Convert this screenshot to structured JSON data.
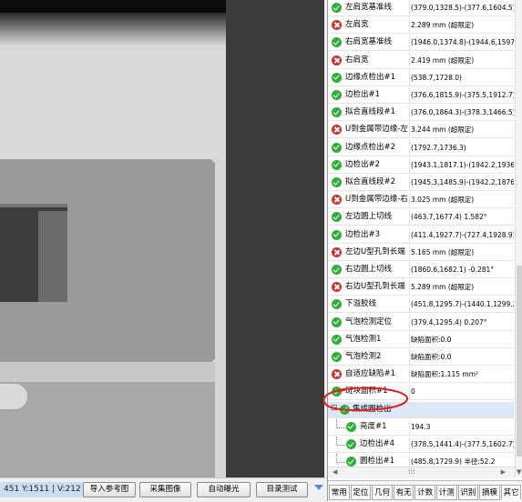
{
  "status_bar": {
    "coords": "451 Y:1511 | V:212",
    "buttons": [
      "导入参考图",
      "采集图像",
      "自动曝光",
      "目录测试"
    ]
  },
  "results": [
    {
      "status": "ok",
      "name": "左肩宽基准线",
      "value": "(379.0,1328.5)-(377.6,1604.5)"
    },
    {
      "status": "fail",
      "name": "左肩宽",
      "value": "2.289 mm (超限定)"
    },
    {
      "status": "ok",
      "name": "右肩宽基准线",
      "value": "(1946.0,1374.8)-(1944.6,1597."
    },
    {
      "status": "fail",
      "name": "右肩宽",
      "value": "2.419 mm (超限定)"
    },
    {
      "status": "ok",
      "name": "边缘点检出#1",
      "value": "(538.7,1728.0)"
    },
    {
      "status": "ok",
      "name": "边检出#1",
      "value": "(376.6,1815.9)-(375.5,1912.7)"
    },
    {
      "status": "ok",
      "name": "拟合直线段#1",
      "value": "(376.0,1864.3)-(378.3,1466.5)"
    },
    {
      "status": "fail",
      "name": "U到金属带边缘-左",
      "value": "3.244 mm (超限定)"
    },
    {
      "status": "ok",
      "name": "边缘点检出#2",
      "value": "(1792.7,1736.3)"
    },
    {
      "status": "ok",
      "name": "边检出#2",
      "value": "(1943.1,1817.1)-(1942.2,1936."
    },
    {
      "status": "ok",
      "name": "拟合直线段#2",
      "value": "(1945.3,1485.9)-(1942.2,1876."
    },
    {
      "status": "fail",
      "name": "U到金属带边缘-右",
      "value": "3.025 mm (超限定)"
    },
    {
      "status": "ok",
      "name": "左边圆上切线",
      "value": "(463.7,1677.4) 1.582°"
    },
    {
      "status": "ok",
      "name": "边检出#3",
      "value": "(411.4,1927.7)-(727.4,1928.9)"
    },
    {
      "status": "fail",
      "name": "左边U型孔到长端",
      "value": "5.165 mm (超限定)"
    },
    {
      "status": "ok",
      "name": "右边圆上切线",
      "value": "(1860.6,1682.1) -0.281°"
    },
    {
      "status": "fail",
      "name": "右边U型孔到长端",
      "value": "5.289 mm (超限定)"
    },
    {
      "status": "ok",
      "name": "下溢胶线",
      "value": "(451.8,1295.7)-(1440.1,1299.2"
    },
    {
      "status": "ok",
      "name": "气泡检测定位",
      "value": "(379.4,1295.4) 0.207°"
    },
    {
      "status": "ok",
      "name": "气泡检测1",
      "value": "缺陷面积:0.0"
    },
    {
      "status": "ok",
      "name": "气泡检测2",
      "value": "缺陷面积:0.0"
    },
    {
      "status": "fail",
      "name": "自适应缺陷#1",
      "value": "缺陷面积:1.115 mm²"
    },
    {
      "status": "ok",
      "name": "斑块面积#1",
      "value": "0"
    },
    {
      "status": "group",
      "name": "集成圆检出",
      "value": ""
    },
    {
      "status": "ok",
      "name": "亮度#1",
      "value": "194.3",
      "child": true
    },
    {
      "status": "ok",
      "name": "边检出#4",
      "value": "(378.5,1441.4)-(377.5,1602.7)",
      "child": true
    },
    {
      "status": "ok",
      "name": "圆检出#1",
      "value": "(485.8,1729.9) 半径:52.2",
      "child": true
    }
  ],
  "tabs": [
    "常用",
    "定位",
    "几何",
    "有无",
    "计数",
    "计测",
    "识别",
    "摘模",
    "其它"
  ],
  "colors": {
    "ok": "#2fae3a",
    "fail": "#d0322b",
    "annotation": "#e02020",
    "selection": "#dce8f6"
  }
}
